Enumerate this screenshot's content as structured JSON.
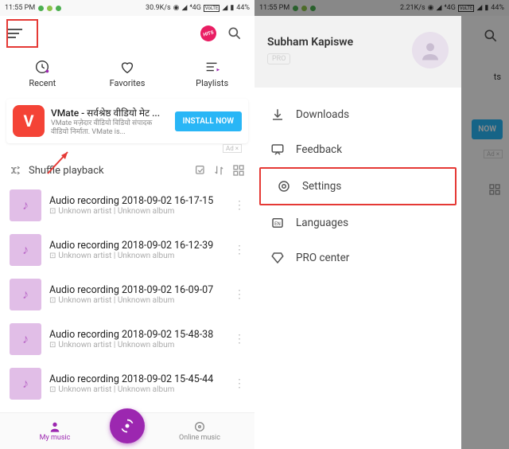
{
  "status": {
    "time": "11:55 PM",
    "speed_left": "30.9K/s",
    "speed_right": "2.21K/s",
    "net": "4G",
    "lte": "VoLTE",
    "battery": "44%"
  },
  "tabs": {
    "recent": "Recent",
    "favorites": "Favorites",
    "playlists": "Playlists"
  },
  "ad": {
    "icon_letter": "V",
    "title": "VMate - सर्वश्रेष्ठ वीडियो मेट ...",
    "sub": "VMate मज़ेदार वीडियो विडियो संपादक वीडियो निर्माता. VMate is...",
    "cta": "INSTALL NOW",
    "tag": "Ad ×"
  },
  "shuffle": {
    "label": "Shuffle playback"
  },
  "tracks": [
    {
      "title": "Audio recording 2018-09-02 16-17-15",
      "sub": "Unknown artist | Unknown album"
    },
    {
      "title": "Audio recording 2018-09-02 16-12-39",
      "sub": "Unknown artist | Unknown album"
    },
    {
      "title": "Audio recording 2018-09-02 16-09-07",
      "sub": "Unknown artist | Unknown album"
    },
    {
      "title": "Audio recording 2018-09-02 15-48-38",
      "sub": "Unknown artist | Unknown album"
    },
    {
      "title": "Audio recording 2018-09-02 15-45-44",
      "sub": "Unknown artist | Unknown album"
    }
  ],
  "bottom": {
    "my_music": "My music",
    "online": "Online music"
  },
  "drawer": {
    "username": "Subham Kapiswe",
    "pro": "PRO",
    "items": {
      "downloads": "Downloads",
      "feedback": "Feedback",
      "settings": "Settings",
      "languages": "Languages",
      "pro_center": "PRO center"
    }
  },
  "right_visible": {
    "install": "NOW"
  }
}
